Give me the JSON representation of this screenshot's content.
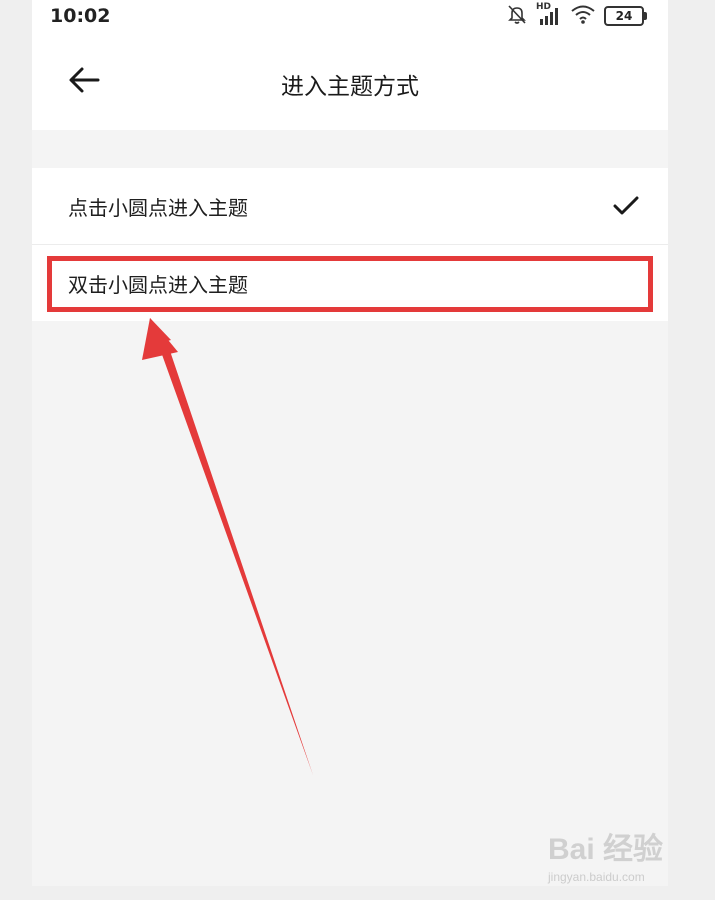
{
  "status_bar": {
    "time": "10:02",
    "network_label": "HD",
    "battery": "24"
  },
  "header": {
    "title": "进入主题方式"
  },
  "options": [
    {
      "label": "点击小圆点进入主题",
      "selected": true
    },
    {
      "label": "双击小圆点进入主题",
      "selected": false
    }
  ],
  "annotation": {
    "color": "#e43a3a",
    "highlighted_option": 1
  },
  "watermark": {
    "logo": "Bai 经验",
    "url": "jingyan.baidu.com"
  }
}
